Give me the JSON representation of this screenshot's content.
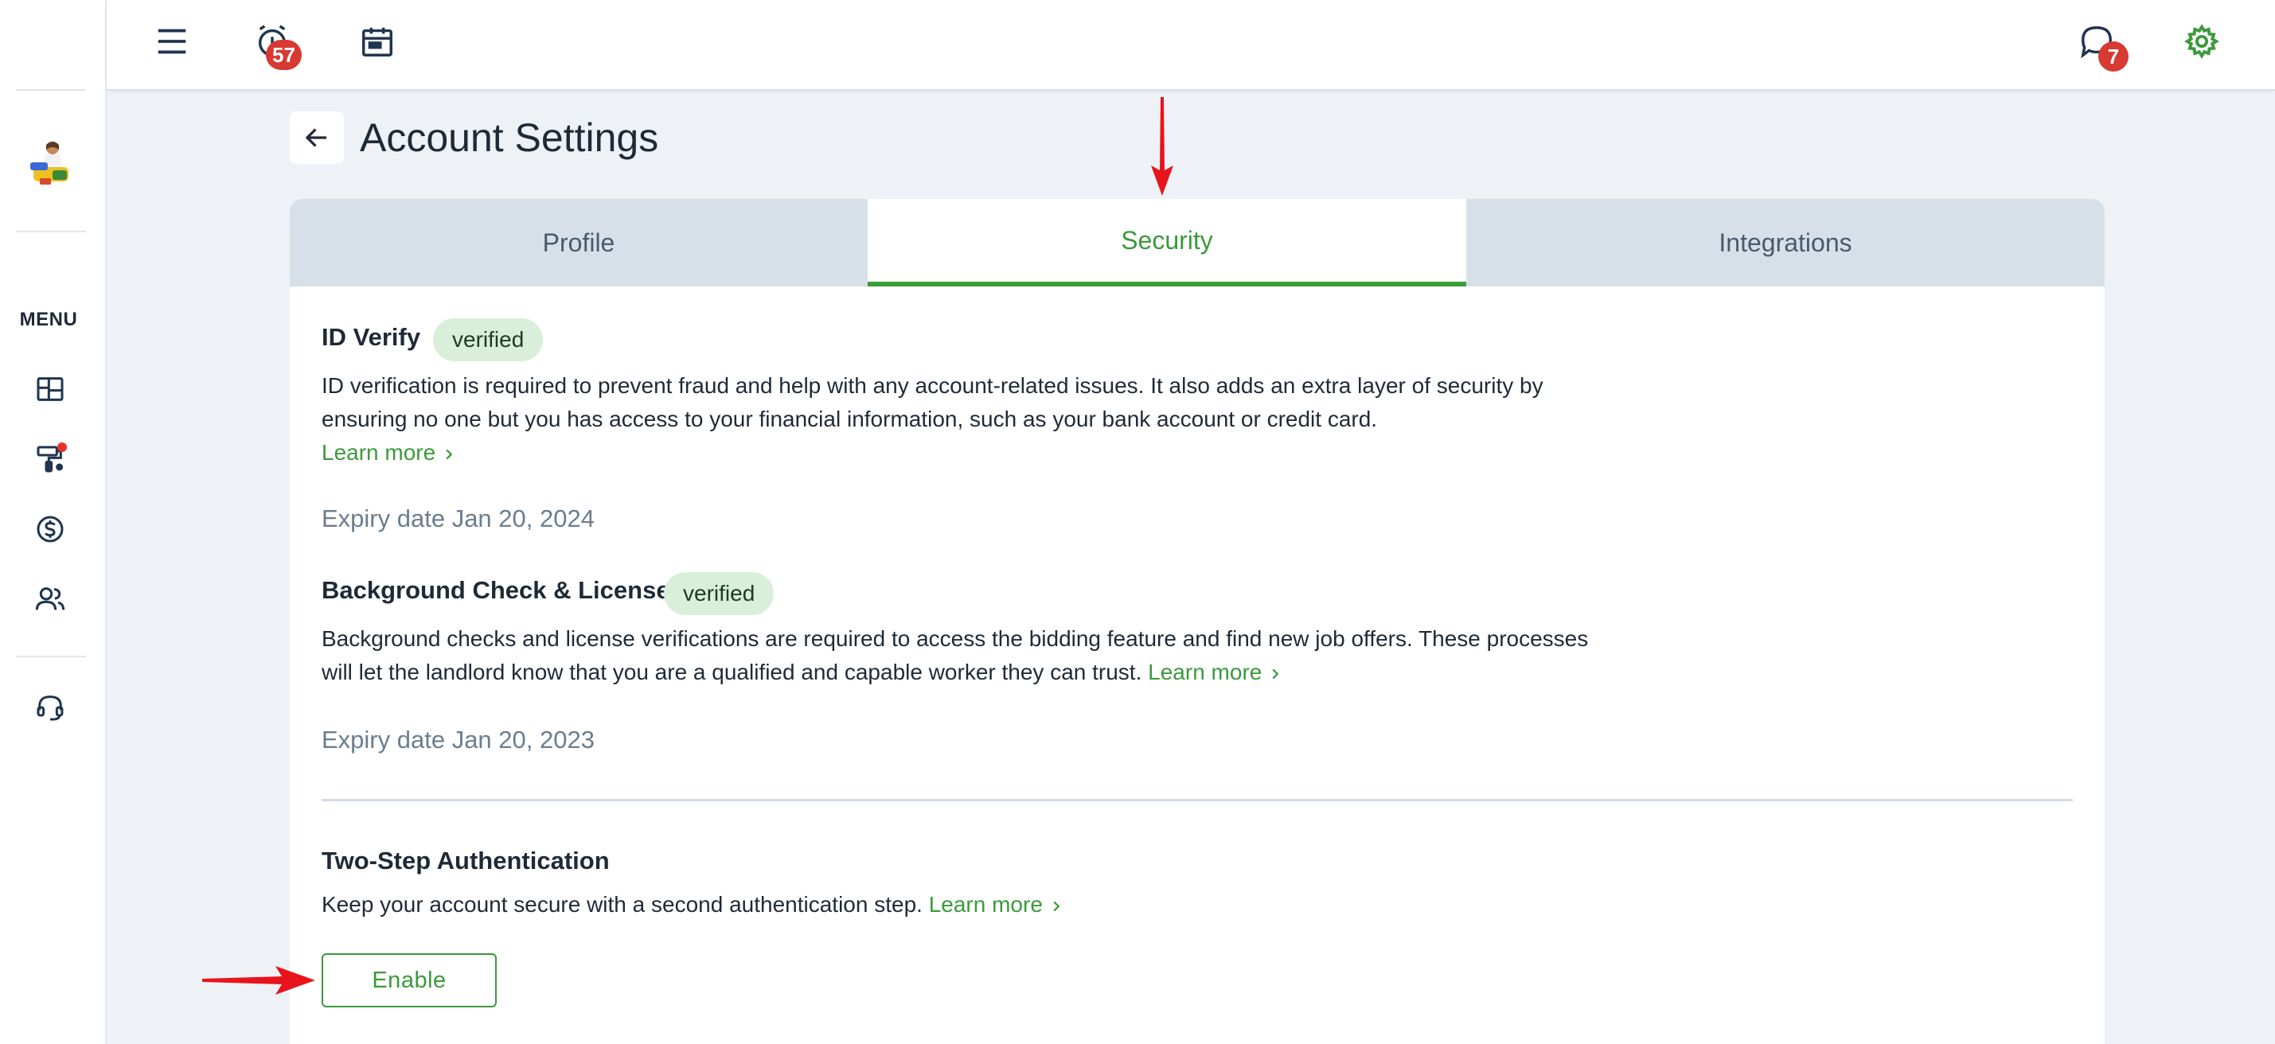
{
  "sidebar": {
    "menu_label": "MENU",
    "items": [
      {
        "icon": "dashboard-icon"
      },
      {
        "icon": "paint-roller-icon",
        "has_notification_dot": true
      },
      {
        "icon": "dollar-circle-icon"
      },
      {
        "icon": "users-icon"
      },
      {
        "icon": "headset-support-icon"
      }
    ]
  },
  "topbar": {
    "menu_icon": "hamburger-menu-icon",
    "alarm_badge": "57",
    "calendar_icon": "calendar-icon",
    "chat_badge": "7",
    "settings_icon": "gear-icon"
  },
  "page": {
    "title": "Account Settings"
  },
  "tabs": [
    {
      "label": "Profile",
      "active": false
    },
    {
      "label": "Security",
      "active": true
    },
    {
      "label": "Integrations",
      "active": false
    }
  ],
  "security": {
    "id_verify": {
      "title": "ID Verify",
      "status": "verified",
      "description": "ID verification is required to prevent fraud and help with any account-related issues. It also adds an extra layer of security by ensuring no one but you has access to your financial information, such as your bank account or credit card.",
      "link": "Learn more",
      "expiry": "Expiry date Jan 20, 2024"
    },
    "background_check": {
      "title": "Background Check & License",
      "status": "verified",
      "description": "Background checks and license verifications are required to access the bidding feature and find new job offers. These processes will let the landlord know that you are a qualified and capable worker they can trust.",
      "link": "Learn more",
      "expiry": "Expiry date Jan 20, 2023"
    },
    "two_step": {
      "title": "Two-Step Authentication",
      "description": "Keep your account secure with a second authentication step.",
      "link": "Learn more",
      "button": "Enable"
    }
  },
  "colors": {
    "accent_green": "#3a9a3a",
    "badge_red": "#d63a32",
    "annotation_red": "#e8141c"
  }
}
